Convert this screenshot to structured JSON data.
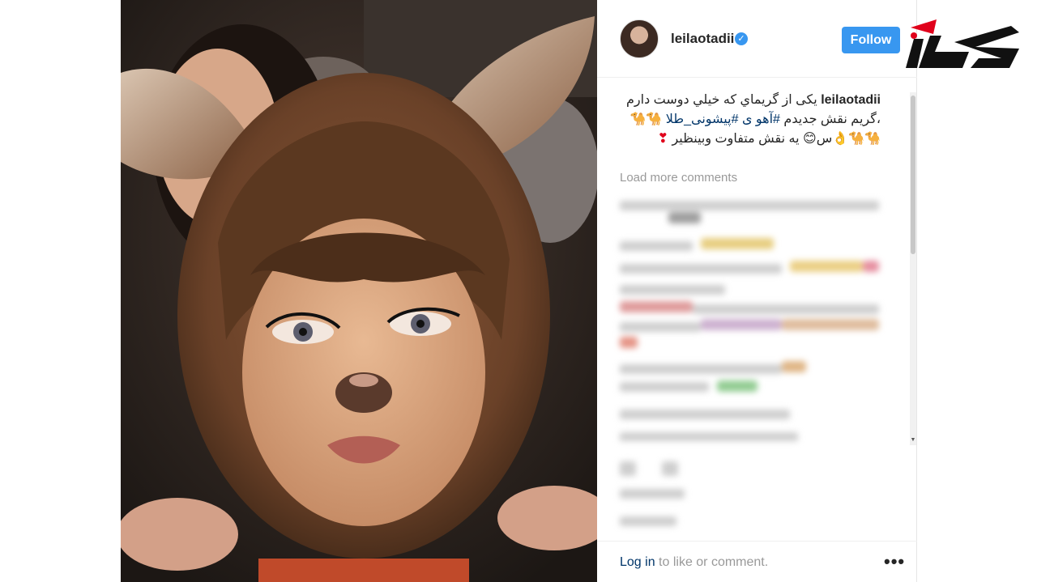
{
  "post": {
    "username": "leilaotadii",
    "verified_icon": "verified-badge-icon",
    "follow_label": "Follow",
    "caption_text": "يکی از گريماي كه خيلي دوست دارم ،گريم نقش جديدم",
    "hashtag_1": "#آهو ی",
    "hashtag_2": "#پيشونی_طلا",
    "caption_tail": "يه نقش متفاوت وبينظير",
    "caption_emojis": "🐪🐪🐪🐪👌س😊",
    "caption_heart": "❣",
    "load_more": "Load more comments",
    "login_link": "Log in",
    "login_suffix": " to like or comment.",
    "more_icon": "more-dots-icon",
    "more_label": "•••"
  },
  "brand": {
    "logo_name": "rokna-logo",
    "accent": "#e0001b",
    "follow_color": "#3897f0"
  }
}
